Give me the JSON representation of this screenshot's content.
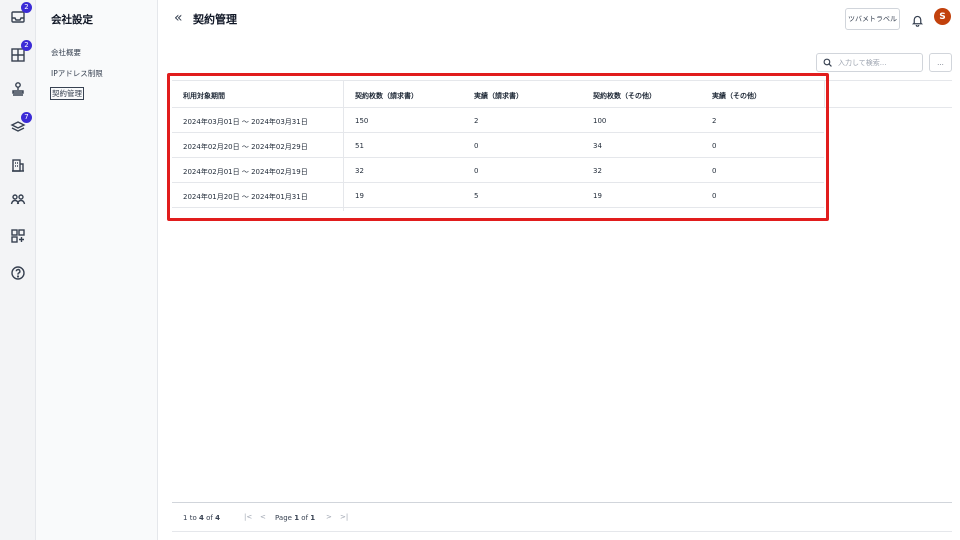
{
  "rail": {
    "badges": {
      "inbox": "2",
      "apps": "2",
      "layers": "7"
    }
  },
  "subnav": {
    "title": "会社設定",
    "items": [
      {
        "label": "会社概要"
      },
      {
        "label": "IPアドレス制限"
      },
      {
        "label": "契約管理"
      }
    ]
  },
  "header": {
    "title": "契約管理",
    "guide_label": "ツバメトラベル",
    "avatar_initial": "S"
  },
  "search": {
    "placeholder": "入力して検索...",
    "more_label": "..."
  },
  "table": {
    "columns": [
      "利用対象期間",
      "契約枚数（請求書）",
      "実績（請求書）",
      "契約枚数（その他）",
      "実績（その他）"
    ],
    "rows": [
      [
        "2024年03月01日 ～ 2024年03月31日",
        "150",
        "2",
        "100",
        "2"
      ],
      [
        "2024年02月20日 ～ 2024年02月29日",
        "51",
        "0",
        "34",
        "0"
      ],
      [
        "2024年02月01日 ～ 2024年02月19日",
        "32",
        "0",
        "32",
        "0"
      ],
      [
        "2024年01月20日 ～ 2024年01月31日",
        "19",
        "5",
        "19",
        "0"
      ]
    ]
  },
  "pagination": {
    "range_start": "1",
    "to_word": "to",
    "range_end": "4",
    "of_word": "of",
    "total": "4",
    "page_word": "Page",
    "current_page": "1",
    "page_of_word": "of",
    "total_pages": "1",
    "first_glyph": "|<",
    "prev_glyph": "<",
    "next_glyph": ">",
    "last_glyph": ">|"
  },
  "colors": {
    "highlight": "#e11d1d",
    "badge": "#3b2bd6",
    "avatar": "#c2410c"
  }
}
